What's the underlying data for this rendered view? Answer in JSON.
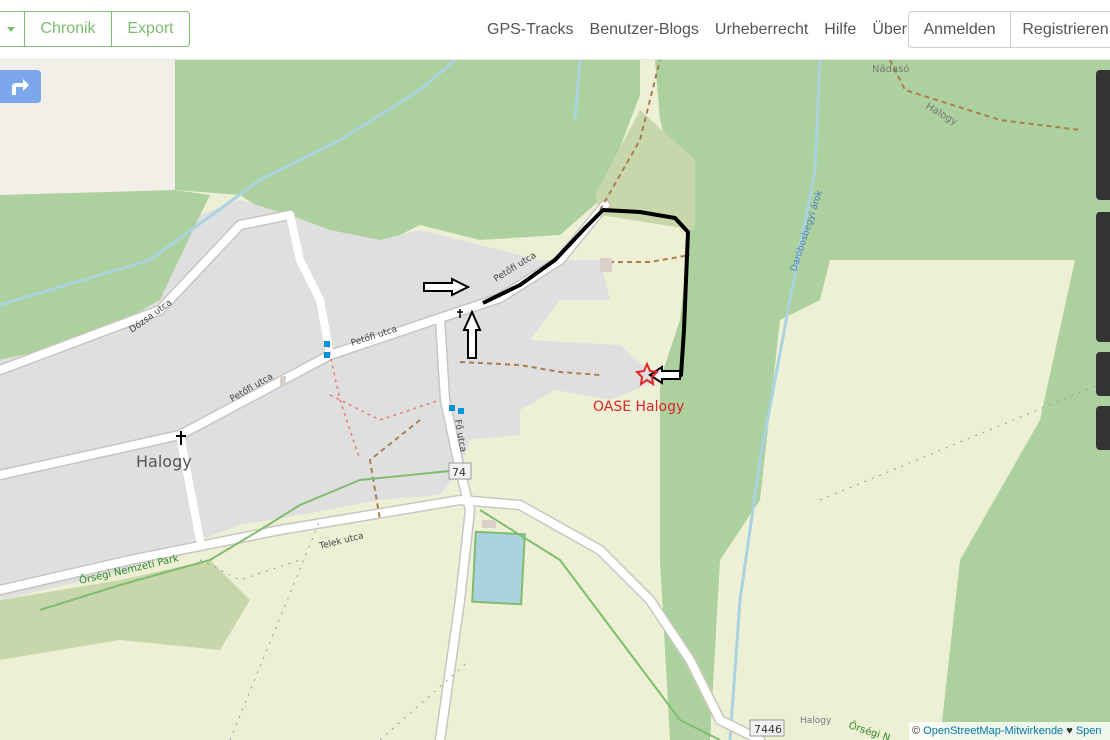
{
  "header": {
    "buttons": {
      "history": "Chronik",
      "export": "Export"
    },
    "nav": [
      "GPS-Tracks",
      "Benutzer-Blogs",
      "Urheberrecht",
      "Hilfe",
      "Über"
    ],
    "auth": {
      "login": "Anmelden",
      "signup": "Registrieren"
    }
  },
  "map": {
    "place_labels": {
      "village": "Halogy",
      "village_north": "Halogy",
      "nadaso": "Nádasó",
      "poi": "OASE Halogy"
    },
    "streets": {
      "petofi_1": "Petőfi utca",
      "petofi_2": "Petőfi utca",
      "petofi_3": "Petőfi utca",
      "dozsa": "Dózsa utca",
      "fo": "Fő utca",
      "telek": "Telek utca",
      "stream": "Daróbosbegyi árok",
      "park": "Őrségi Nemzeti Park",
      "park_2": "Őrségi N",
      "halogy_road": "Halogy"
    },
    "road_shields": {
      "main": "74",
      "minor": "7446"
    },
    "colors": {
      "forest": "#add19e",
      "residential": "#e0dfdf",
      "farmland": "#eef0d5",
      "road": "#ffffff",
      "water": "#aad3df",
      "route": "#000000",
      "poi": "#e3262a",
      "poi_label": "#d8262a"
    },
    "icons": [
      "directions-icon",
      "church-icon",
      "star-marker-icon",
      "arrow-right-icon",
      "arrow-up-icon",
      "arrow-left-icon"
    ]
  },
  "attribution": {
    "prefix": "©",
    "link": "OpenStreetMap-Mitwirkende",
    "heart": "♥",
    "more": "Spen"
  }
}
